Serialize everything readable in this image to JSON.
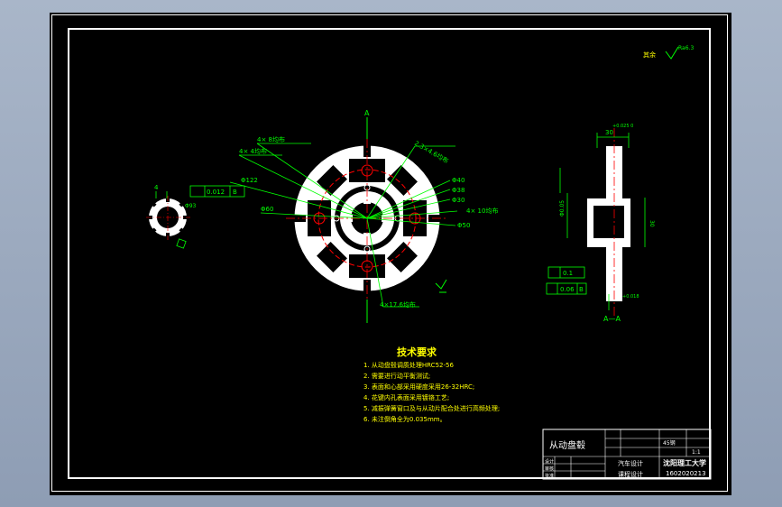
{
  "drawing": {
    "roughness_note": "其余",
    "roughness_value": "Ra6.3",
    "section_marker": "A",
    "section_view_label": "A—A",
    "dims": {
      "four_x_8": "4× 8均布",
      "four_x_4": "4× 4均布",
      "four_x_10": "4× 10均布",
      "four_x_17_6": "4×17.6均布",
      "angled": "2.3×4.6均布",
      "d122": "Φ122",
      "d60": "Φ60",
      "d40": "Φ40",
      "d38": "Φ38",
      "d30": "Φ30",
      "d50": "Φ50",
      "d30b": "Φ30",
      "d4": "4",
      "tol_flat": "0.012",
      "datum_b": "B",
      "d93": "Φ93",
      "dim30": "30",
      "tol_top": "+0.025 0",
      "d30_side": "30",
      "d0_05": "Φ0.05",
      "d0_1": "0.1",
      "d0_06": "0.06",
      "datum_b2": "B",
      "tol_side": "+0.018"
    },
    "tech_req": {
      "title": "技术要求",
      "items": [
        "1. 从动盘毂调质处理HRC52-56",
        "2. 需要进行动平衡测试;",
        "3. 表面和心部采用硬度采用26-32HRC;",
        "4. 花键内孔表面采用镀铬工艺;",
        "5. 减振弹簧窗口及与从动片配合处进行高频处理;",
        "6. 未注倒角全为0.035mm。"
      ]
    },
    "title_block": {
      "part_name": "从动盘毂",
      "c1": "设计",
      "c2": "审核",
      "c3": "批准",
      "material": "45钢",
      "scale": "1:1",
      "course": "汽车设计",
      "sub": "课程设计",
      "school": "沈阳理工大学",
      "number": "1602020213"
    }
  },
  "colors": {
    "background": "#000000",
    "line_white": "#ffffff",
    "dim_green": "#00ff00",
    "center_red": "#ff0000",
    "annot_yellow": "#ffff00"
  }
}
